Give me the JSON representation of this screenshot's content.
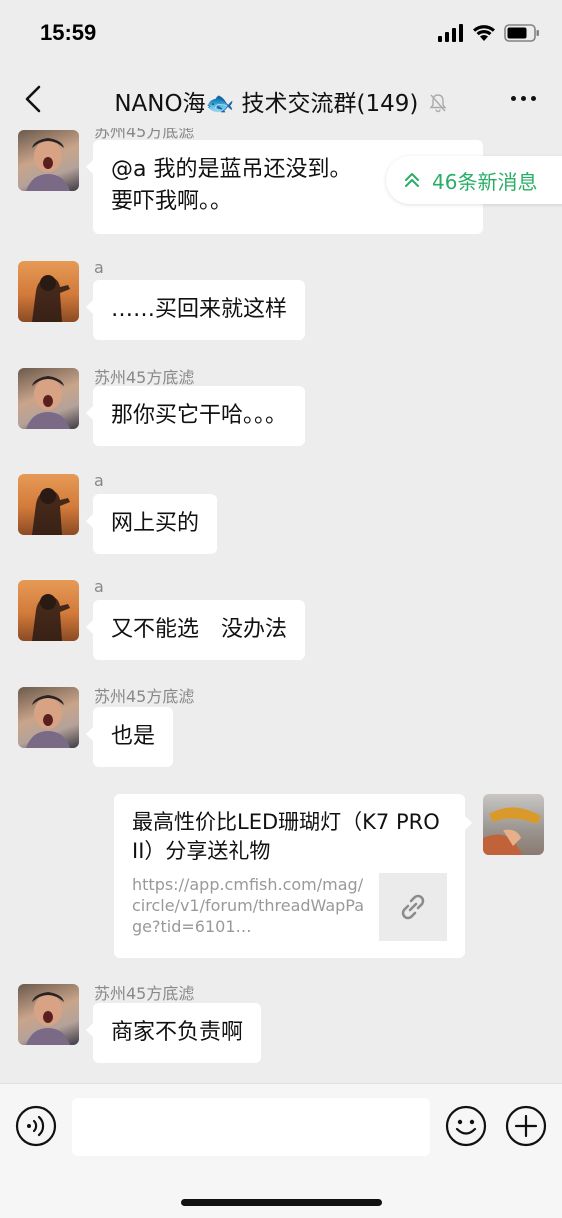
{
  "status": {
    "time": "15:59"
  },
  "header": {
    "title": "NANO海🐟 技术交流群(149)"
  },
  "new_messages": {
    "label": "46条新消息"
  },
  "messages": [
    {
      "sender": "苏州45方底滤",
      "text_line1": "@a 我的是蓝吊还没到。",
      "text_line2": "要吓我啊。。"
    },
    {
      "sender": "a",
      "text": "……买回来就这样"
    },
    {
      "sender": "苏州45方底滤",
      "text": "那你买它干哈。。。"
    },
    {
      "sender": "a",
      "text": "网上买的"
    },
    {
      "sender": "a",
      "text": "又不能选　没办法"
    },
    {
      "sender": "苏州45方底滤",
      "text": "也是"
    },
    {
      "sender": "苏州45方底滤",
      "text": "商家不负责啊"
    }
  ],
  "link_card": {
    "title": "最高性价比LED珊瑚灯（K7 PRO II）分享送礼物",
    "url": "https://app.cmfish.com/mag/circle/v1/forum/threadWapPage?tid=6101…"
  },
  "colors": {
    "accent": "#2aae67",
    "background": "#ededed",
    "bubble": "#ffffff"
  }
}
